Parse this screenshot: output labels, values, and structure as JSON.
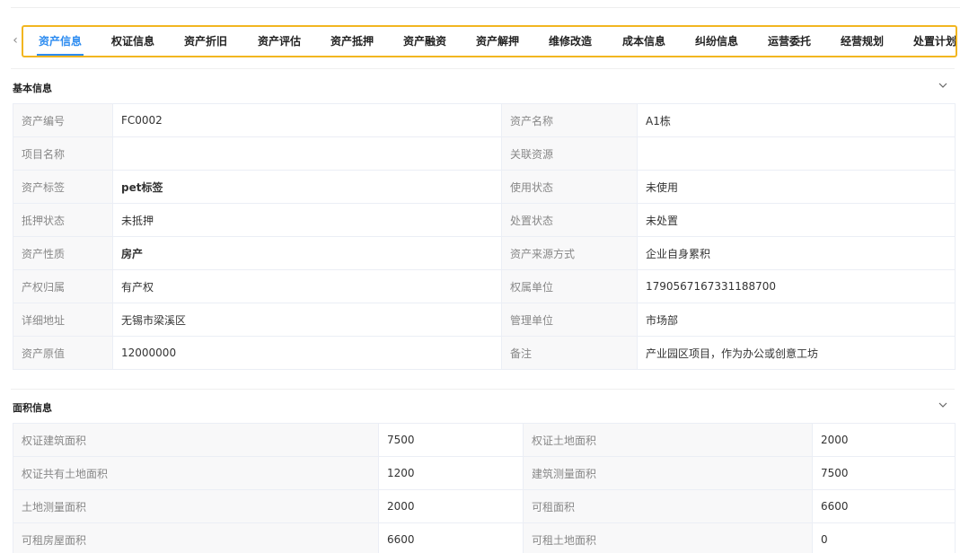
{
  "tabs": [
    {
      "label": "资产信息",
      "active": true
    },
    {
      "label": "权证信息"
    },
    {
      "label": "资产折旧"
    },
    {
      "label": "资产评估"
    },
    {
      "label": "资产抵押"
    },
    {
      "label": "资产融资"
    },
    {
      "label": "资产解押"
    },
    {
      "label": "维修改造"
    },
    {
      "label": "成本信息"
    },
    {
      "label": "纠纷信息"
    },
    {
      "label": "运营委托"
    },
    {
      "label": "经营规划"
    },
    {
      "label": "处置计划"
    }
  ],
  "arrows": {
    "left": "‹",
    "right": "›"
  },
  "basic": {
    "title": "基本信息",
    "rows": [
      [
        {
          "label": "资产编号",
          "value": "FC0002"
        },
        {
          "label": "资产名称",
          "value": "A1栋"
        }
      ],
      [
        {
          "label": "项目名称",
          "value": ""
        },
        {
          "label": "关联资源",
          "value": ""
        }
      ],
      [
        {
          "label": "资产标签",
          "value": "pet标签",
          "bold": true
        },
        {
          "label": "使用状态",
          "value": "未使用"
        }
      ],
      [
        {
          "label": "抵押状态",
          "value": "未抵押"
        },
        {
          "label": "处置状态",
          "value": "未处置"
        }
      ],
      [
        {
          "label": "资产性质",
          "value": "房产",
          "bold": true
        },
        {
          "label": "资产来源方式",
          "value": "企业自身累积"
        }
      ],
      [
        {
          "label": "产权归属",
          "value": "有产权"
        },
        {
          "label": "权属单位",
          "value": "1790567167331188700"
        }
      ],
      [
        {
          "label": "详细地址",
          "value": "无锡市梁溪区"
        },
        {
          "label": "管理单位",
          "value": "市场部"
        }
      ],
      [
        {
          "label": "资产原值",
          "value": "12000000"
        },
        {
          "label": "备注",
          "value": "产业园区项目，作为办公或创意工坊"
        }
      ]
    ]
  },
  "area": {
    "title": "面积信息",
    "rows": [
      [
        {
          "label": "权证建筑面积",
          "value": "7500"
        },
        {
          "label": "权证土地面积",
          "value": "2000"
        }
      ],
      [
        {
          "label": "权证共有土地面积",
          "value": "1200"
        },
        {
          "label": "建筑测量面积",
          "value": "7500"
        }
      ],
      [
        {
          "label": "土地测量面积",
          "value": "2000"
        },
        {
          "label": "可租面积",
          "value": "6600"
        }
      ],
      [
        {
          "label": "可租房屋面积",
          "value": "6600"
        },
        {
          "label": "可租土地面积",
          "value": "0"
        }
      ]
    ]
  }
}
